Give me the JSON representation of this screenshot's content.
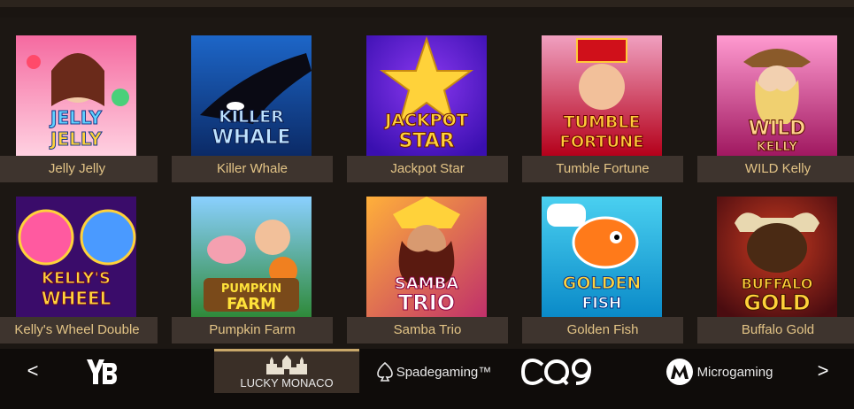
{
  "games": [
    {
      "name": "Jelly Jelly",
      "art_line1": "JELLY",
      "art_line2": "JELLY",
      "colors": [
        "#f56aa0",
        "#ffd1e1"
      ],
      "text_color": "#5fd1ff"
    },
    {
      "name": "Killer Whale",
      "art_line1": "KILLER",
      "art_line2": "WHALE",
      "colors": [
        "#0b2a66",
        "#1d66c8"
      ],
      "text_color": "#bfe3ff"
    },
    {
      "name": "Jackpot Star",
      "art_line1": "JACKPOT",
      "art_line2": "STAR",
      "colors": [
        "#3a0fb0",
        "#8a38f0"
      ],
      "text_color": "#ffd23a"
    },
    {
      "name": "Tumble Fortune",
      "art_line1": "TUMBLE",
      "art_line2": "FORTUNE",
      "colors": [
        "#b4001a",
        "#f0a0c0"
      ],
      "text_color": "#ffcb3a"
    },
    {
      "name": "WILD Kelly",
      "art_line1": "WILD",
      "art_line2": "KELLY",
      "colors": [
        "#a01860",
        "#ff9ad0"
      ],
      "text_color": "#ffd28a"
    },
    {
      "name": "Kelly's Wheel Double",
      "art_line1": "KELLY'S",
      "art_line2": "WHEEL",
      "colors": [
        "#3a0c6a",
        "#ff5aa0"
      ],
      "text_color": "#ffd23a"
    },
    {
      "name": "Pumpkin Farm",
      "art_line1": "PUMPKIN",
      "art_line2": "FARM",
      "colors": [
        "#2f8a3a",
        "#8ad0ff"
      ],
      "text_color": "#ffe23a"
    },
    {
      "name": "Samba Trio",
      "art_line1": "SAMBA",
      "art_line2": "TRIO",
      "colors": [
        "#c0306a",
        "#ffb03a"
      ],
      "text_color": "#ffffff"
    },
    {
      "name": "Golden Fish",
      "art_line1": "GOLDEN",
      "art_line2": "FISH",
      "colors": [
        "#0a8ac8",
        "#4ad0f0"
      ],
      "text_color": "#ffd23a"
    },
    {
      "name": "Buffalo Gold",
      "art_line1": "BUFFALO",
      "art_line2": "GOLD",
      "colors": [
        "#4a0c10",
        "#c83a20"
      ],
      "text_color": "#ffd23a"
    }
  ],
  "providers": {
    "prev_arrow": "<",
    "next_arrow": ">",
    "items": [
      {
        "name": "YB",
        "icon": "yb-logo"
      },
      {
        "name": "LUCKY MONACO",
        "icon": "castle-logo",
        "active": true
      },
      {
        "name": "Spadegaming™",
        "icon": "spade-logo"
      },
      {
        "name": "CQ9",
        "icon": "cq9-logo"
      },
      {
        "name": "Microgaming",
        "icon": "microgaming-logo"
      }
    ]
  },
  "colors": {
    "caption_bg": "#3e342e",
    "caption_text": "#e3c486",
    "active_provider_bg": "#3a2f27",
    "active_provider_accent": "#c9a86a"
  }
}
